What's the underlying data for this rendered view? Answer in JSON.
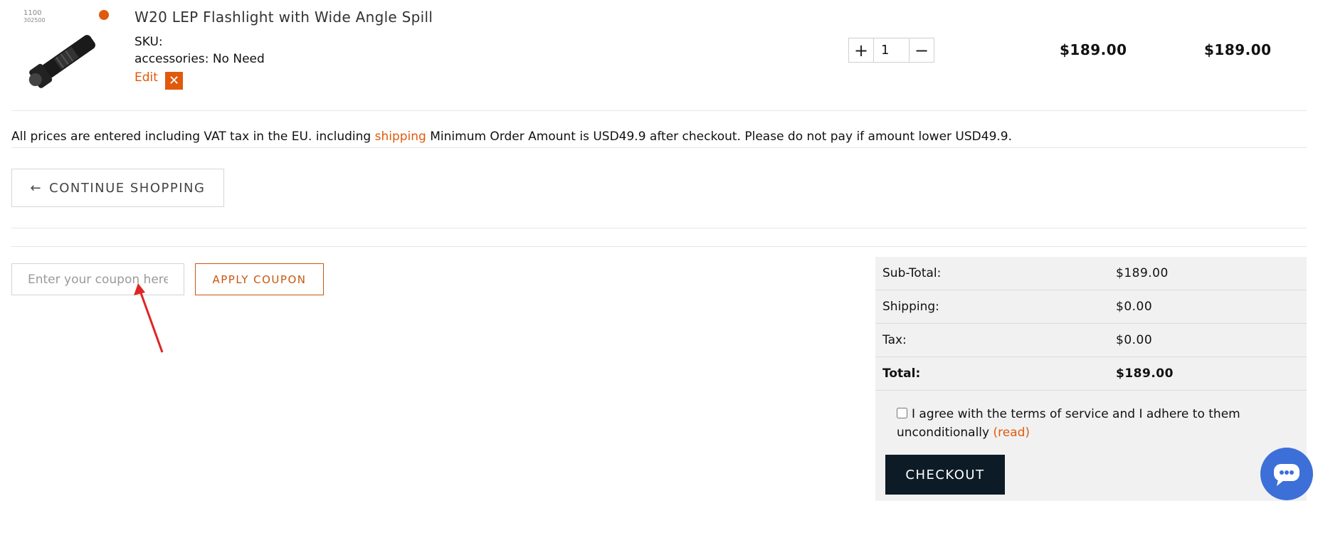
{
  "cart_item": {
    "image_alt_text": "1100 lumens",
    "title": "W20 LEP Flashlight with Wide Angle Spill",
    "sku_label": "SKU:",
    "accessories_label": "accessories: No Need",
    "edit_label": "Edit",
    "remove_icon": "close-icon",
    "quantity": "1",
    "price": "$189.00",
    "line_total": "$189.00"
  },
  "notice": {
    "before": "All prices are entered including VAT tax in the EU. including ",
    "link": "shipping",
    "after": " Minimum Order Amount is USD49.9 after checkout. Please do not pay if amount lower USD49.9."
  },
  "continue_shopping": "CONTINUE SHOPPING",
  "coupon": {
    "placeholder": "Enter your coupon here",
    "apply_label": "APPLY COUPON"
  },
  "totals": {
    "subtotal_label": "Sub-Total:",
    "subtotal_value": "$189.00",
    "shipping_label": "Shipping:",
    "shipping_value": "$0.00",
    "tax_label": "Tax:",
    "tax_value": "$0.00",
    "total_label": "Total:",
    "total_value": "$189.00"
  },
  "terms": {
    "text": "I agree with the terms of service and I adhere to them unconditionally",
    "link": "(read)"
  },
  "checkout_label": "CHECKOUT",
  "colors": {
    "accent": "#e05a0c",
    "checkout_bg": "#0d1b26",
    "chat_bubble": "#3d6fd8",
    "annotation_arrow": "#e02424"
  }
}
